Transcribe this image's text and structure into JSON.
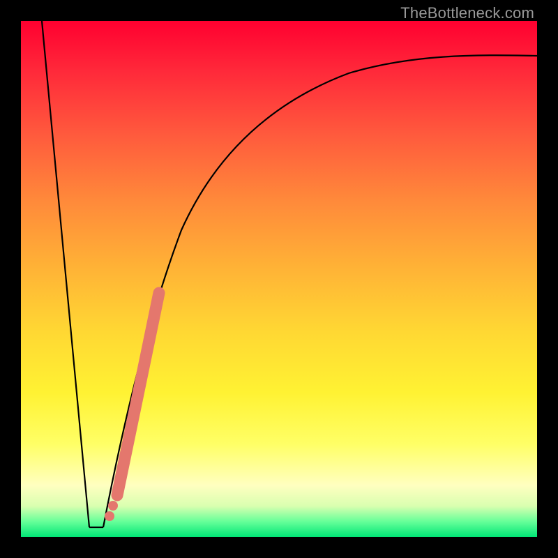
{
  "watermark": "TheBottleneck.com",
  "chart_data": {
    "type": "line",
    "title": "",
    "xlabel": "",
    "ylabel": "",
    "xlim": [
      0,
      100
    ],
    "ylim": [
      0,
      100
    ],
    "grid": false,
    "legend": false,
    "series": [
      {
        "name": "left-descent",
        "x": [
          4,
          13
        ],
        "y": [
          100,
          2
        ],
        "stroke": "#000000"
      },
      {
        "name": "valley-floor",
        "x": [
          13,
          16
        ],
        "y": [
          2,
          2
        ],
        "stroke": "#000000"
      },
      {
        "name": "recovery-curve",
        "x": [
          16,
          18,
          20,
          22,
          24,
          27,
          30,
          34,
          38,
          44,
          52,
          62,
          74,
          86,
          100
        ],
        "y": [
          2,
          12,
          22,
          32,
          41,
          52,
          60,
          68,
          74,
          80,
          84,
          87.5,
          90,
          91.5,
          92.5
        ],
        "stroke": "#000000"
      },
      {
        "name": "highlight-band",
        "x": [
          18.5,
          26.5
        ],
        "y": [
          8,
          47
        ],
        "stroke": "#e4776d",
        "stroke_width": 12
      },
      {
        "name": "highlight-dot-1",
        "x": [
          17.5
        ],
        "y": [
          4.5
        ],
        "stroke": "#e4776d",
        "marker": "circle",
        "marker_r": 6
      },
      {
        "name": "highlight-dot-2",
        "x": [
          18.0
        ],
        "y": [
          6.5
        ],
        "stroke": "#e4776d",
        "marker": "circle",
        "marker_r": 6
      }
    ]
  }
}
